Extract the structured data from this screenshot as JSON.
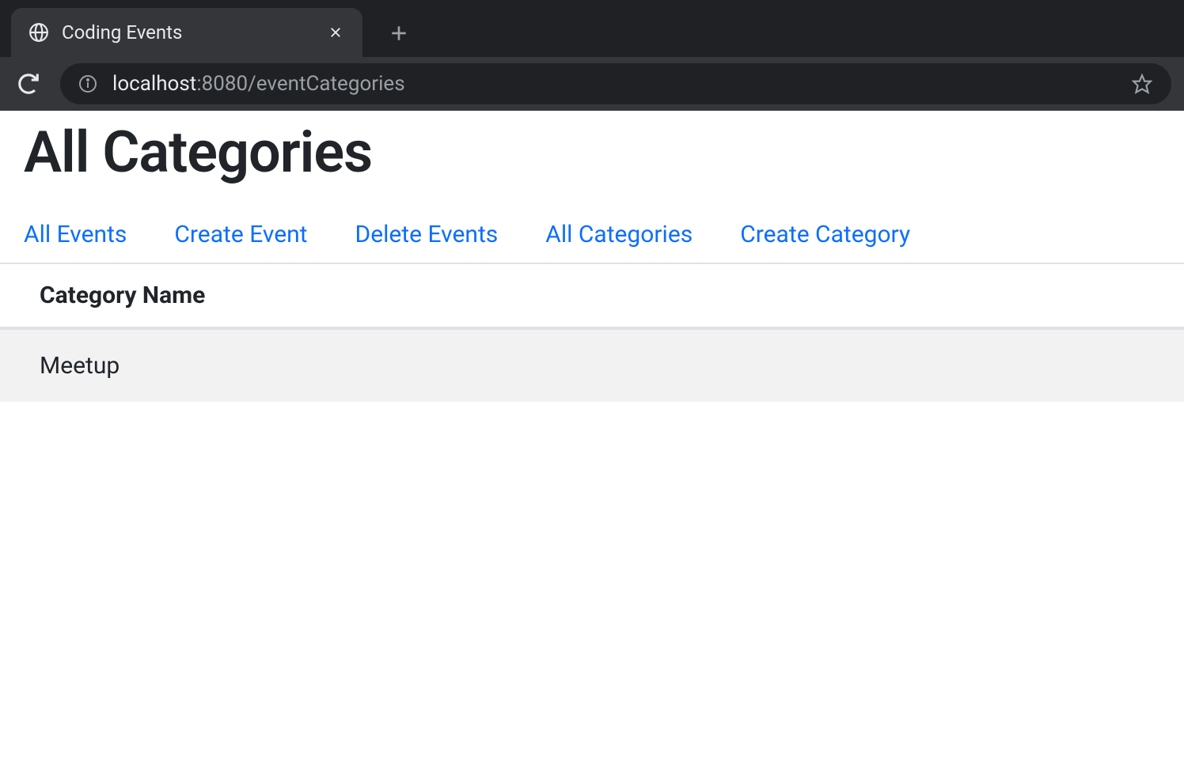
{
  "browser": {
    "tab": {
      "title": "Coding Events"
    },
    "url": {
      "host": "localhost",
      "path": ":8080/eventCategories"
    }
  },
  "page": {
    "title": "All Categories"
  },
  "nav": {
    "links": [
      {
        "label": "All Events"
      },
      {
        "label": "Create Event"
      },
      {
        "label": "Delete Events"
      },
      {
        "label": "All Categories"
      },
      {
        "label": "Create Category"
      }
    ]
  },
  "table": {
    "header": "Category Name",
    "rows": [
      {
        "name": "Meetup"
      }
    ]
  }
}
